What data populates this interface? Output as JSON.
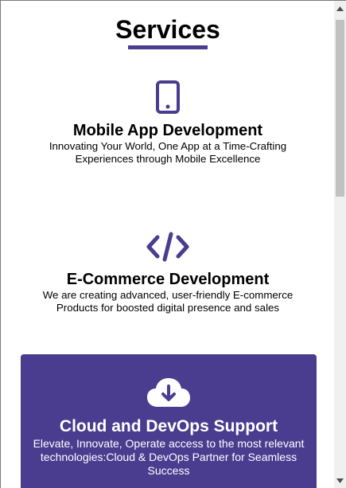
{
  "section": {
    "title": "Services"
  },
  "services": [
    {
      "icon": "mobile-phone-icon",
      "title": "Mobile App Development",
      "description": "Innovating Your World, One App at a Time-Crafting Experiences through Mobile Excellence"
    },
    {
      "icon": "code-icon",
      "title": "E-Commerce Development",
      "description": "We are creating advanced, user-friendly E-commerce Products for boosted digital presence and sales"
    },
    {
      "icon": "cloud-download-icon",
      "title": "Cloud and DevOps Support",
      "description": "Elevate, Innovate, Operate access to the most relevant technologies:Cloud & DevOps Partner for Seamless Success"
    }
  ],
  "colors": {
    "accent": "#4a3d8f",
    "card_text": "#ffffff",
    "scrollbar_track": "#f0f0f0",
    "scrollbar_thumb": "#c1c1c1"
  }
}
